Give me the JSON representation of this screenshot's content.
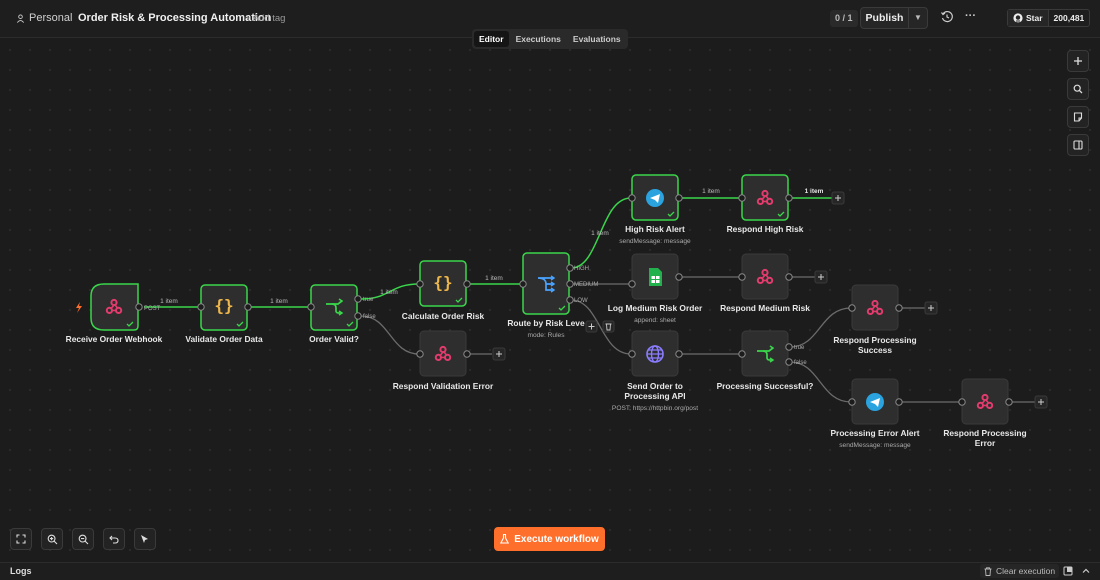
{
  "header": {
    "project": "Personal",
    "workflow_title": "Order Risk & Processing Automation",
    "add_tag": "+ Add tag",
    "counter": "0 / 1",
    "publish_label": "Publish",
    "github_star": "Star",
    "github_count": "200,481"
  },
  "tabs": [
    {
      "label": "Editor",
      "active": true
    },
    {
      "label": "Executions",
      "active": false
    },
    {
      "label": "Evaluations",
      "active": false
    }
  ],
  "nodes": {
    "receive_webhook": {
      "label": "Receive Order Webhook",
      "icon": "webhook-icon"
    },
    "validate_data": {
      "label": "Validate Order Data",
      "icon": "code-braces-icon"
    },
    "order_valid": {
      "label": "Order Valid?",
      "icon": "if-branch-icon"
    },
    "calculate_risk": {
      "label": "Calculate Order Risk",
      "icon": "code-braces-icon"
    },
    "respond_validation_error": {
      "label": "Respond Validation Error",
      "icon": "webhook-icon"
    },
    "route_by_risk": {
      "label": "Route by Risk Leve",
      "sub": "mode: Rules",
      "icon": "switch-icon"
    },
    "high_risk_alert": {
      "label": "High Risk Alert",
      "sub": "sendMessage: message",
      "icon": "telegram-icon"
    },
    "respond_high_risk": {
      "label": "Respond High Risk",
      "icon": "webhook-icon"
    },
    "log_medium_risk": {
      "label": "Log Medium Risk Order",
      "sub": "append: sheet",
      "icon": "sheets-icon"
    },
    "respond_medium_risk": {
      "label": "Respond Medium Risk",
      "icon": "webhook-icon"
    },
    "send_order_api": {
      "label1": "Send Order to",
      "label2": "Processing API",
      "sub": "POST: https://httpbin.org/post",
      "icon": "globe-icon"
    },
    "processing_successful": {
      "label": "Processing Successful?",
      "icon": "if-branch-icon"
    },
    "respond_processing_success": {
      "label1": "Respond Processing",
      "label2": "Success",
      "icon": "webhook-icon"
    },
    "processing_error_alert": {
      "label": "Processing Error Alert",
      "sub": "sendMessage: message",
      "icon": "telegram-icon"
    },
    "respond_processing_error": {
      "label1": "Respond Processing",
      "label2": "Error",
      "icon": "webhook-icon"
    }
  },
  "connections": {
    "item_label": "1 item",
    "post": "POST",
    "true": "true",
    "false": "false",
    "high": "HIGH",
    "medium": "MEDIUM",
    "low": "LOW"
  },
  "bottom": {
    "execute_label": "Execute workflow",
    "logs_label": "Logs",
    "clear_execution": "Clear execution"
  },
  "colors": {
    "success": "#3ad64b",
    "accent": "#ff6f2c",
    "node_bg": "#2e2e2e",
    "webhook": "#e33b6e",
    "telegram": "#2aa3df",
    "sheets": "#22b14c",
    "code": "#f0b84a"
  }
}
